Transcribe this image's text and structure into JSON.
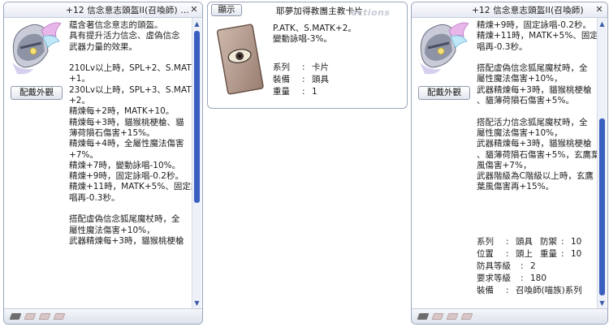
{
  "left_window": {
    "title": "+12 信念意志頭盔II(召喚師) ...",
    "close_glyph": "✕",
    "equip_button": "配戴外觀",
    "description": [
      "蘊含著信念意志的頭盔。",
      "具有提升活力信念、虛偽信念",
      "武器力量的效果。",
      "",
      "210Lv以上時，SPL+2、S.MATK",
      "+1。",
      "230Lv以上時，SPL+3、S.MATK",
      "+2。",
      "精煉每+2時，MATK+10。",
      "精煉每+3時，貓猴桃梗槍、貓",
      "薄荷隕石傷害+15%。",
      "精煉每+4時，全屬性魔法傷害",
      "+7%。",
      "精煉+7時，變動詠唱-10%。",
      "精煉+9時，固定詠唱-0.2秒。",
      "精煉+11時，MATK+5%、固定詠",
      "唱再-0.3秒。",
      "",
      "搭配虛偽信念狐尾魔杖時，全",
      "屬性魔法傷害+10%，",
      "武器精煉每+3時，貓猴桃梗槍"
    ]
  },
  "middle_window": {
    "show_button": "顯示",
    "title": "耶夢加得教團主教卡片",
    "watermark": "ections",
    "description": [
      "P.ATK、S.MATK+2。",
      "變動詠唱-3%。"
    ],
    "properties": [
      {
        "key": "系列",
        "value": "卡片"
      },
      {
        "key": "裝備",
        "value": "頭具"
      },
      {
        "key": "重量",
        "value": "1"
      }
    ]
  },
  "right_window": {
    "title": "+12 信念意志頭盔II(召喚師)",
    "close_glyph": "✕",
    "equip_button": "配戴外觀",
    "description": [
      "精煉+9時，固定詠唱-0.2秒。",
      "精煉+11時，MATK+5%、固定詠",
      "唱再-0.3秒。",
      "",
      "搭配虛偽信念狐尾魔杖時，全",
      "屬性魔法傷害+10%，",
      "武器精煉每+3時，貓猴桃梗槍",
      "、貓薄荷隕石傷害+5%。",
      "",
      "搭配活力信念狐尾魔杖時，全",
      "屬性魔法傷害+10%，",
      "武器精煉每+3時，貓猴桃梗槍",
      "、貓薄荷隕石傷害+5%，玄鷹葉",
      "風傷害+7%，",
      "武器階級為C階級以上時，玄鷹",
      "葉風傷害再+15%。"
    ],
    "properties": [
      {
        "k1": "系列",
        "v1": "頭具",
        "k2": "防禦",
        "v2": "10"
      },
      {
        "k1": "位置",
        "v1": "頭上",
        "k2": "重量",
        "v2": "10"
      }
    ],
    "props_single": [
      {
        "key": "防具等級",
        "value": "2"
      },
      {
        "key": "要求等級",
        "value": "180"
      },
      {
        "key": "裝備",
        "value": "召喚師(喵族)系列"
      }
    ]
  },
  "colors": {
    "border": "#9aa6bd",
    "scroll_thumb": "#3b5fc0"
  }
}
